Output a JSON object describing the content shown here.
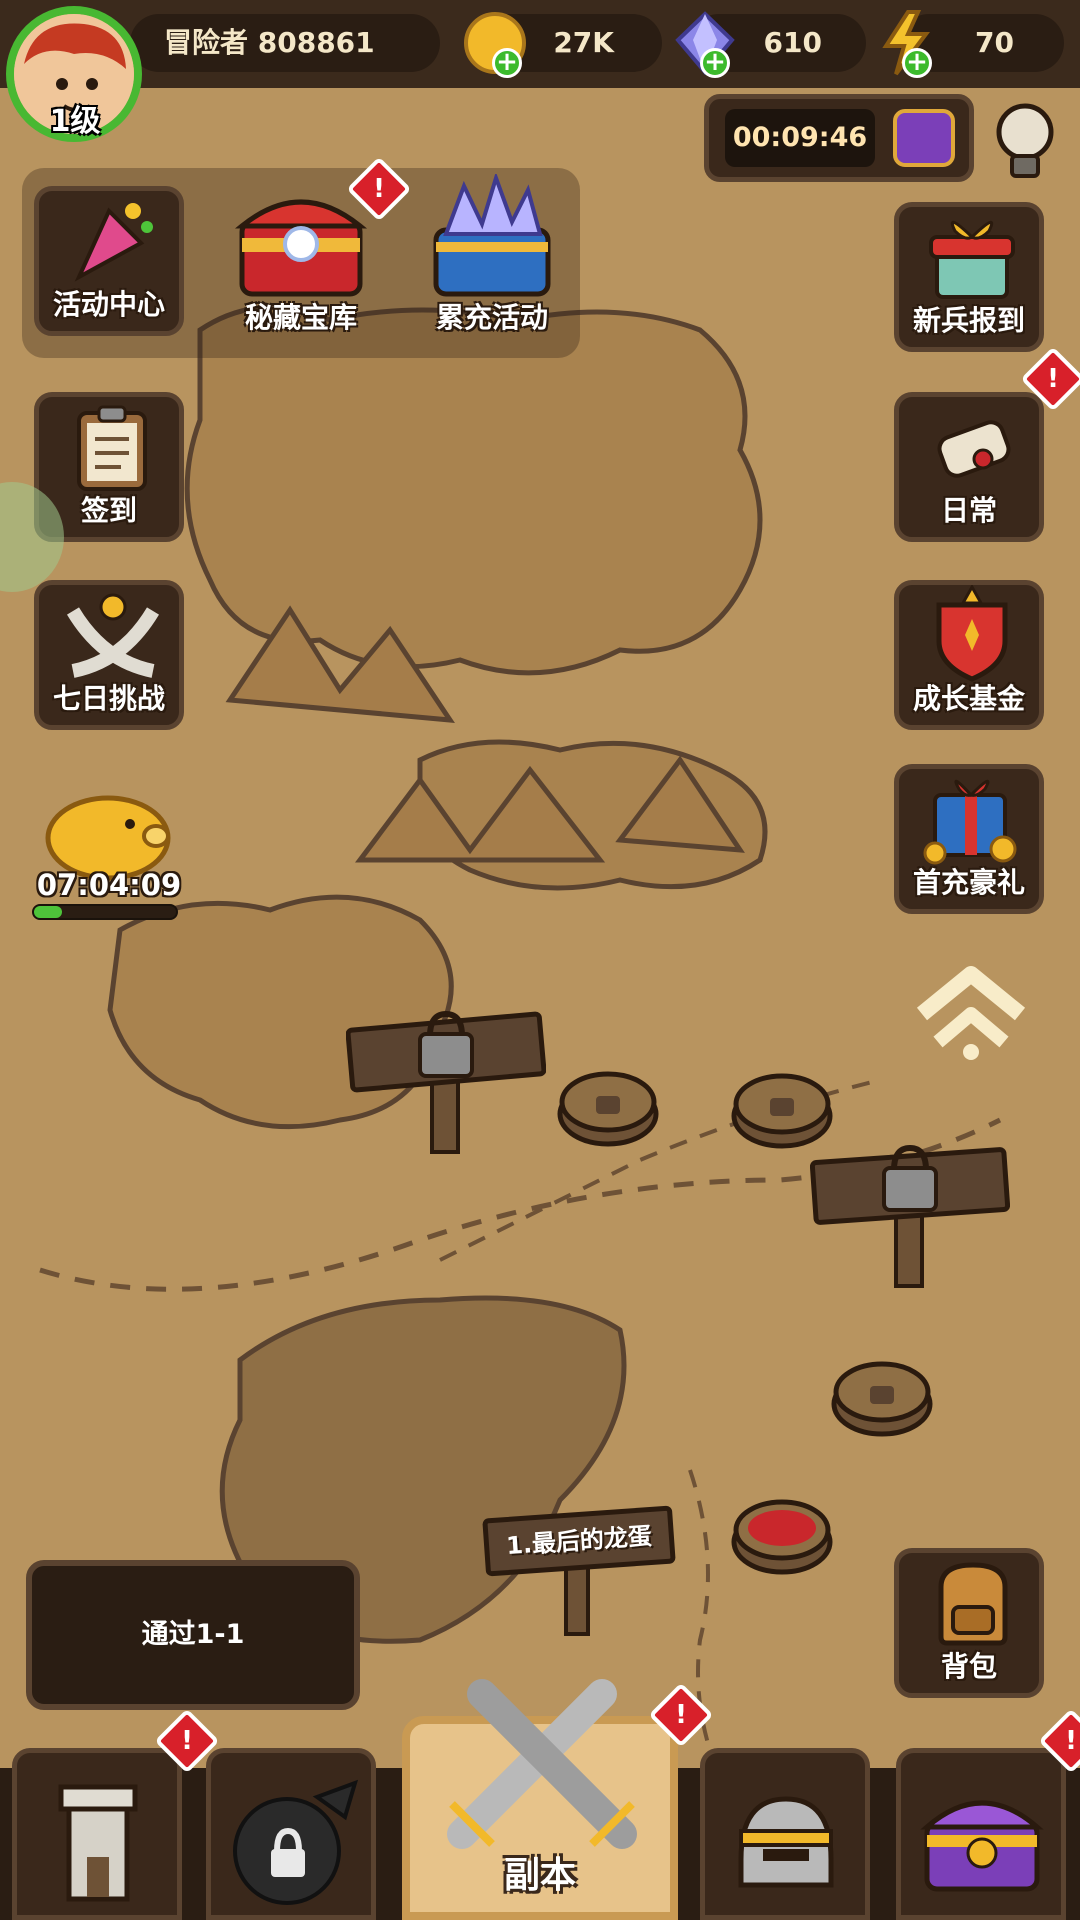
{
  "player": {
    "name": "冒险者 808861",
    "level": "1级"
  },
  "currencies": {
    "gold": "27K",
    "gems": "610",
    "energy": "70"
  },
  "timer": "00:09:46",
  "left_menu": [
    {
      "label": "活动中心",
      "icon": "party-popper-icon"
    },
    {
      "label": "秘藏宝库",
      "icon": "treasure-chest-icon"
    },
    {
      "label": "累充活动",
      "icon": "crystal-chest-icon"
    },
    {
      "label": "签到",
      "icon": "clipboard-icon"
    },
    {
      "label": "七日挑战",
      "icon": "crossed-swords-icon"
    }
  ],
  "right_menu": [
    {
      "label": "新兵报到",
      "icon": "gift-box-icon"
    },
    {
      "label": "日常",
      "icon": "scroll-icon"
    },
    {
      "label": "成长基金",
      "icon": "shield-crest-icon"
    },
    {
      "label": "首充豪礼",
      "icon": "gift-coins-icon"
    },
    {
      "label": "背包",
      "icon": "backpack-icon"
    }
  ],
  "piggy": {
    "timer": "07:04:09",
    "progress": 0.2
  },
  "stage_sign": "1.最后的龙蛋",
  "quest": "通过1-1",
  "bottom_nav": {
    "main_label": "副本"
  },
  "badge_text": "!",
  "colors": {
    "accent_green": "#48b832",
    "badge_red": "#d8202a",
    "map_bg": "#b8945f",
    "panel_dark": "#3a281b"
  }
}
